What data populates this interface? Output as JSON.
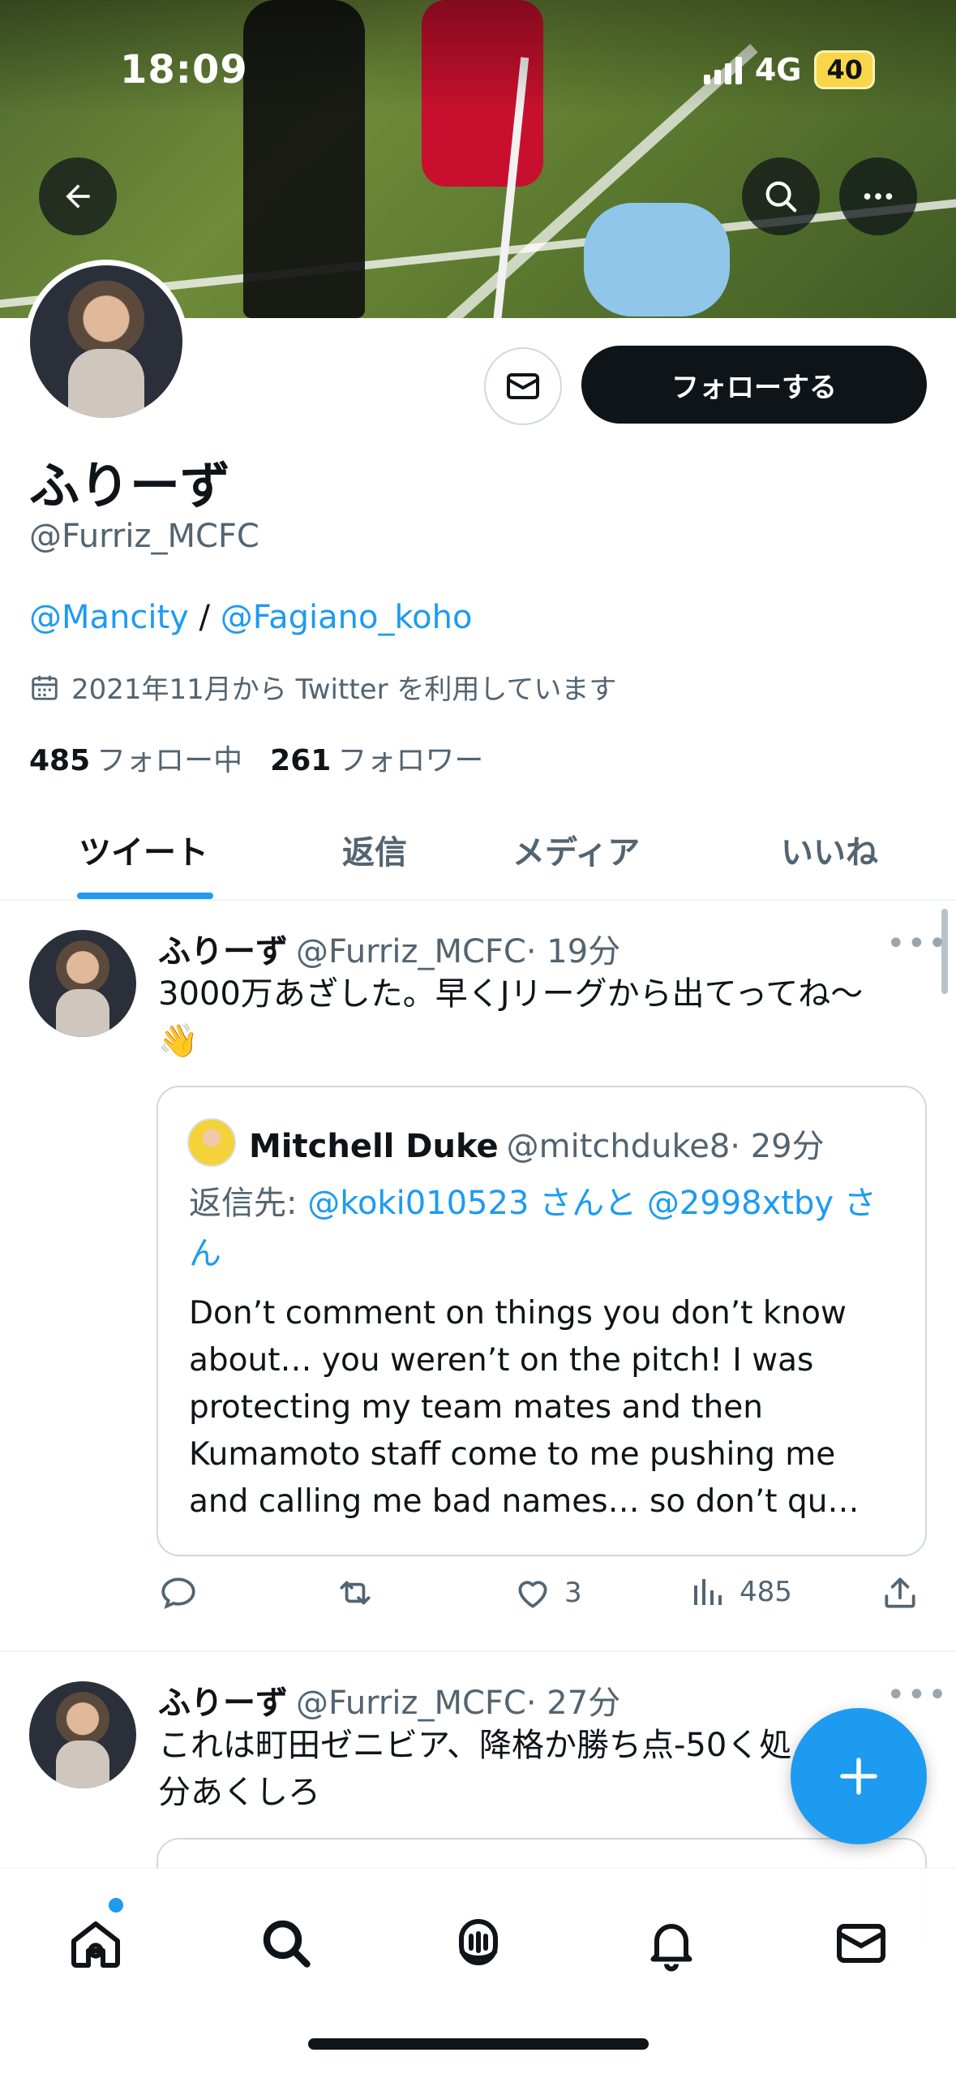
{
  "status_bar": {
    "time": "18:09",
    "network": "4G",
    "battery": "40"
  },
  "profile": {
    "name": "ふりーず",
    "handle": "@Furriz_MCFC",
    "bio": {
      "link1": "@Mancity",
      "separator": " / ",
      "link2": "@Fagiano_koho"
    },
    "joined": "2021年11月から Twitter を利用しています",
    "following_count": "485",
    "following_label": "フォロー中",
    "followers_count": "261",
    "followers_label": "フォロワー",
    "follow_button": "フォローする"
  },
  "tabs": [
    {
      "label": "ツイート",
      "active": true
    },
    {
      "label": "返信",
      "active": false
    },
    {
      "label": "メディア",
      "active": false
    },
    {
      "label": "いいね",
      "active": false
    }
  ],
  "tweets": [
    {
      "name": "ふりーず",
      "handle": "@Furriz_MCFC",
      "time": "· 19分",
      "text": "3000万あざした。早くJリーグから出てってね〜👋",
      "quote": {
        "name": "Mitchell Duke",
        "handle": "@mitchduke8",
        "time": "· 29分",
        "reply_prefix": "返信先: ",
        "reply_user1": "@koki010523",
        "reply_mid": " さんと ",
        "reply_user2": "@2998xtby",
        "reply_suffix": " さん",
        "text": "Don’t comment on things you don’t know about… you weren’t on the pitch! I was protecting my team mates and then Kumamoto staff come to me pushing me and calling me bad names… so don’t qu…"
      },
      "likes": "3",
      "views": "485"
    },
    {
      "name": "ふりーず",
      "handle": "@Furriz_MCFC",
      "time": "· 27分",
      "text": "これは町田ゼニビア、降格か勝ち点-50く処分あくしろ"
    }
  ],
  "icons": {
    "back": "arrow-left-icon",
    "search": "search-icon",
    "more": "more-icon",
    "message": "envelope-icon",
    "compose": "plus-icon"
  },
  "colors": {
    "accent": "#1d9bf0",
    "text": "#0f1419",
    "muted": "#536471"
  }
}
